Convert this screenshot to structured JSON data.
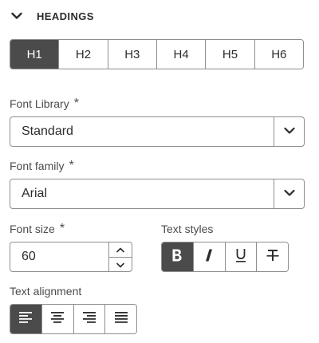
{
  "section": {
    "title": "HEADINGS",
    "expanded": true,
    "icon": "chevron-down-icon"
  },
  "headings": {
    "options": [
      "H1",
      "H2",
      "H3",
      "H4",
      "H5",
      "H6"
    ],
    "selected": "H1"
  },
  "font_library": {
    "label": "Font Library",
    "required_mark": "*",
    "value": "Standard",
    "icon": "chevron-down-icon"
  },
  "font_family": {
    "label": "Font family",
    "required_mark": "*",
    "value": "Arial",
    "icon": "chevron-down-icon"
  },
  "font_size": {
    "label": "Font size",
    "required_mark": "*",
    "value": "60"
  },
  "text_styles": {
    "label": "Text styles",
    "buttons": [
      {
        "name": "bold",
        "icon": "bold-icon",
        "active": true
      },
      {
        "name": "italic",
        "icon": "italic-icon",
        "active": false
      },
      {
        "name": "underline",
        "icon": "underline-icon",
        "active": false
      },
      {
        "name": "strikethrough",
        "icon": "strikethrough-icon",
        "active": false
      }
    ]
  },
  "text_alignment": {
    "label": "Text alignment",
    "buttons": [
      {
        "name": "left",
        "icon": "align-left-icon",
        "active": true
      },
      {
        "name": "center",
        "icon": "align-center-icon",
        "active": false
      },
      {
        "name": "right",
        "icon": "align-right-icon",
        "active": false
      },
      {
        "name": "justify",
        "icon": "align-justify-icon",
        "active": false
      }
    ]
  },
  "colors": {
    "selected_bg": "#4b4b4b",
    "border": "#8e8e8e",
    "text": "#2c2c2c"
  }
}
